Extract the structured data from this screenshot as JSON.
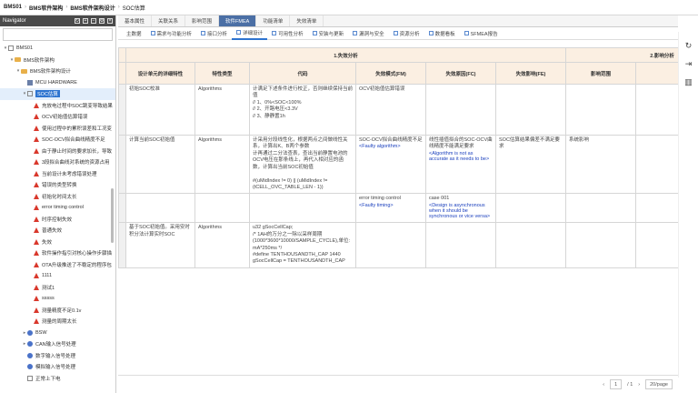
{
  "breadcrumb": [
    "BMS01",
    "BMS软件架构",
    "BMS软件架构设计",
    "SOC估算"
  ],
  "navigator": {
    "title": "Navigator",
    "items": [
      {
        "label": "BMS01",
        "depth": 0,
        "icon": "grid-icon",
        "toggle": "▾"
      },
      {
        "label": "BMS软件架构",
        "depth": 1,
        "icon": "folder-icon",
        "toggle": "▾"
      },
      {
        "label": "BMS软件架构设计",
        "depth": 2,
        "icon": "folder-icon",
        "toggle": "▾"
      },
      {
        "label": "MCU HARDWARE",
        "depth": 3,
        "icon": "doc-icon",
        "toggle": ""
      },
      {
        "label": "SOC估算",
        "depth": 3,
        "icon": "grid-icon",
        "toggle": "▾",
        "selected": true
      },
      {
        "label": "充放电过程中SOC跳变导致结果",
        "depth": 4,
        "icon": "warning-icon",
        "toggle": ""
      },
      {
        "label": "OCV初始值估算错误",
        "depth": 4,
        "icon": "warning-icon",
        "toggle": ""
      },
      {
        "label": "使用过程中的累积误差和工况变",
        "depth": 4,
        "icon": "warning-icon",
        "toggle": ""
      },
      {
        "label": "SOC-OCV拟合曲线精度不足",
        "depth": 4,
        "icon": "warning-icon",
        "toggle": ""
      },
      {
        "label": "由于静止时间的要求加长，导致",
        "depth": 4,
        "icon": "warning-icon",
        "toggle": ""
      },
      {
        "label": "3段拟合曲线对系统的资源占用",
        "depth": 4,
        "icon": "warning-icon",
        "toggle": ""
      },
      {
        "label": "当前设计未考虑错误处理",
        "depth": 4,
        "icon": "warning-icon",
        "toggle": ""
      },
      {
        "label": "错误的类型转换",
        "depth": 4,
        "icon": "warning-icon",
        "toggle": ""
      },
      {
        "label": "初始化时间太长",
        "depth": 4,
        "icon": "warning-icon",
        "toggle": ""
      },
      {
        "label": "error timing control",
        "depth": 4,
        "icon": "warning-icon",
        "toggle": ""
      },
      {
        "label": "时序控制失效",
        "depth": 4,
        "icon": "warning-icon",
        "toggle": ""
      },
      {
        "label": "普通失效",
        "depth": 4,
        "icon": "warning-icon",
        "toggle": ""
      },
      {
        "label": "失效",
        "depth": 4,
        "icon": "warning-icon",
        "toggle": ""
      },
      {
        "label": "软件操作指引对核心操作步骤描",
        "depth": 4,
        "icon": "warning-icon",
        "toggle": ""
      },
      {
        "label": "OTA升级推送了不稳定的程序包",
        "depth": 4,
        "icon": "warning-icon",
        "toggle": ""
      },
      {
        "label": "1111",
        "depth": 4,
        "icon": "warning-icon",
        "toggle": ""
      },
      {
        "label": "测试1",
        "depth": 4,
        "icon": "warning-icon",
        "toggle": ""
      },
      {
        "label": "sssss",
        "depth": 4,
        "icon": "warning-icon",
        "toggle": ""
      },
      {
        "label": "测量精度不足0.1v",
        "depth": 4,
        "icon": "warning-icon",
        "toggle": ""
      },
      {
        "label": "测量的周期太长",
        "depth": 4,
        "icon": "warning-icon",
        "toggle": ""
      },
      {
        "label": "BSW",
        "depth": 3,
        "icon": "circle-icon",
        "toggle": "▸"
      },
      {
        "label": "CAN输入信号处理",
        "depth": 3,
        "icon": "circle-icon",
        "toggle": "▸"
      },
      {
        "label": "数字输入信号处理",
        "depth": 3,
        "icon": "circle-icon",
        "toggle": ""
      },
      {
        "label": "模拟输入信号处理",
        "depth": 3,
        "icon": "circle-icon",
        "toggle": ""
      },
      {
        "label": "正常上下电",
        "depth": 3,
        "icon": "grid-icon",
        "toggle": ""
      }
    ]
  },
  "tabs": [
    "基本属性",
    "关联关系",
    "影响范围",
    "软件FMEA",
    "功能清单",
    "失效清单"
  ],
  "active_tab": 3,
  "subtabs": [
    "主数据",
    "需求与功能分析",
    "接口分析",
    "详细设计",
    "可用性分析",
    "安装与更新",
    "漏洞与安全",
    "资源分析",
    "数据看板",
    "SFMEA报告"
  ],
  "active_subtab": 3,
  "table": {
    "group1": "1.失效分析",
    "group2": "2.影响分析",
    "headers": [
      "设计单元的详细特性",
      "特性类型",
      "代码",
      "失效模式(FM)",
      "失效原因(FC)",
      "失效影响(FE)",
      "影响范围",
      "预防措"
    ],
    "rows": [
      {
        "unit": "初始SOC校准",
        "type": "Algorithms",
        "code": "计满足下述条件进行校正，否则继续保持当前值\n// 1、0%<SOC<100%\n// 2、开路电压<3.3V\n// 3、静静置1h",
        "fm": "OCV初始值估算错误",
        "fm_blue": "",
        "fc": "",
        "fc_blue": "",
        "fe": "",
        "scope": ""
      },
      {
        "unit": "计算当前SOC初始值",
        "type": "Algorithms",
        "code": "计采用分段线性化，根据两点之间做线性关系，计算出K、B两个参数\n计再通过二分法查表，查出当前静置电池的OCV电压在那条线上，再代入相对应的函数，计算出当前SOC初始值\n\n#(uMidIndex != 0) || (uMidIndex != (tCELL_OVC_TABLE_LEN - 1))",
        "fm": "SOC-OCV拟合曲线精度不足",
        "fm_blue": "<Faulty algorithm>",
        "fc": "线性插值拟合的SOC-OCV曲线精度不能满足要求",
        "fc_blue": "<Algorithm is not as accurate as it needs to be>",
        "fe": "SOC估算结果偏差不满足要求",
        "scope": "系统影响"
      },
      {
        "unit": "",
        "type": "",
        "code": "",
        "fm": "error timing control",
        "fm_blue": "<Faulty timing>",
        "fc": "case 001",
        "fc_blue": "<Design is asynchronous when it should be synchronous or vice versa>",
        "fe": "",
        "scope": ""
      },
      {
        "unit": "基于SOC初始值。采用安时积分法计算实时SOC",
        "type": "Algorithms",
        "code": "u32 gSocCellCap;\n/* 1AH的万分之一除以采样周期(1000*3600*10000/SAMPLE_CYCLE),单位: mA*250ms */\n#define TENTHOUSANDTH_CAP 1440\ngSocCellCap = TENTHOUSANDTH_CAP",
        "fm": "",
        "fm_blue": "",
        "fc": "",
        "fc_blue": "",
        "fe": "",
        "scope": ""
      }
    ]
  },
  "pager": {
    "page": "1",
    "total": "/ 1",
    "page_size": "20/page"
  }
}
